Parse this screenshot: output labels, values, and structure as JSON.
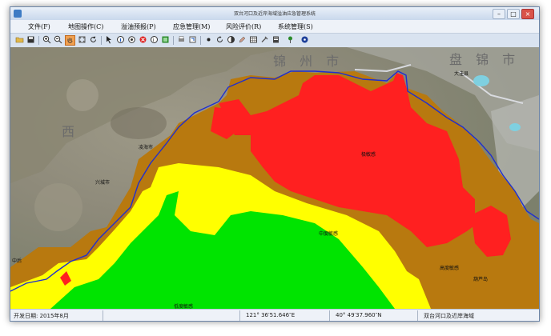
{
  "window": {
    "title": "双台河口及近岸海域溢油应急管理系统"
  },
  "menu": [
    {
      "id": "file",
      "label": "文件(F)"
    },
    {
      "id": "map",
      "label": "地图操作(C)"
    },
    {
      "id": "forecast",
      "label": "溢油预报(P)"
    },
    {
      "id": "emergency",
      "label": "应急管理(M)"
    },
    {
      "id": "risk",
      "label": "风险评价(R)"
    },
    {
      "id": "system",
      "label": "系统管理(S)"
    }
  ],
  "toolbar": {
    "icons": [
      "open-icon",
      "save-icon",
      "zoom-in-icon",
      "zoom-out-icon",
      "pan-hand-icon",
      "full-extent-icon",
      "refresh-icon",
      "select-arrow-icon",
      "identify-icon",
      "layer-icon",
      "delete-icon",
      "query-icon",
      "legend-icon",
      "print-icon",
      "export-icon",
      "draw-point-icon",
      "rotate-icon",
      "measure-icon",
      "edit-icon",
      "table-icon",
      "tool-icon",
      "report-icon",
      "pin-icon",
      "help-icon"
    ],
    "active_index": 4
  },
  "map": {
    "city_labels": [
      "锦 州 市",
      "盘 锦 市",
      "西"
    ],
    "place_labels": [
      "大洼县",
      "凌海市",
      "兴城市",
      "中后",
      "葫芦岛"
    ],
    "zone_labels": {
      "extreme": "极敏感",
      "medium": "中度敏感",
      "high": "高度敏感",
      "low": "低度敏感"
    },
    "zone_colors": {
      "extreme": "#ff2020",
      "high": "#b8790f",
      "medium": "#ffff00",
      "low": "#00e400"
    },
    "coastline_color": "#1f2fd0"
  },
  "status": {
    "dev_date": "开发日期: 2015年8月",
    "longitude": "121° 36′51.646″E",
    "latitude": "40° 49′37.960″N",
    "region": "双台河口及近岸海域"
  }
}
